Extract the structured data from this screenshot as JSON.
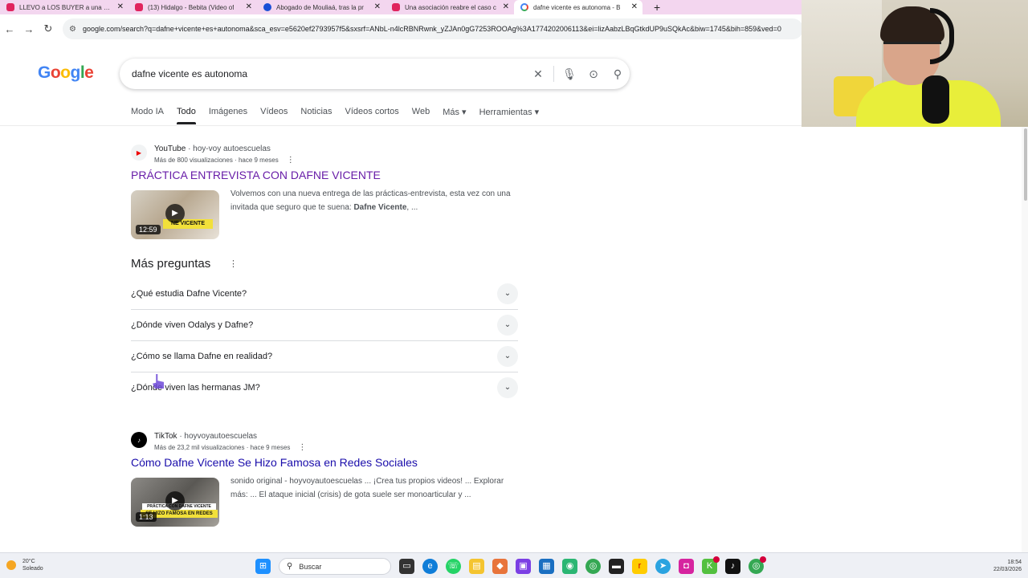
{
  "browser": {
    "tabs": [
      {
        "title": "LLEVO a LOS BUYER a una CLA",
        "favicon": "youtube-icon"
      },
      {
        "title": "(13) Hidalgo - Bebita (Video of",
        "favicon": "youtube-icon"
      },
      {
        "title": "Abogado de Mouliaá, tras la pr",
        "favicon": "facebook-icon"
      },
      {
        "title": "Una asociación reabre el caso c",
        "favicon": "youtube-icon"
      },
      {
        "title": "dafne vicente es autonoma - B",
        "favicon": "google-icon"
      }
    ],
    "new_tab": "+",
    "url": "google.com/search?q=dafne+vicente+es+autonoma&sca_esv=e5620ef2793957f5&sxsrf=ANbL-n4lcRBNRwnk_yZJAn0gG7253ROOAg%3A1774202006113&ei=lizAabzLBqGtkdUP9uSQkAc&biw=1745&bih=859&ved=0"
  },
  "search": {
    "logo": [
      "G",
      "o",
      "o",
      "g",
      "l",
      "e"
    ],
    "query": "dafne vicente es autonoma",
    "tabs": [
      "Modo IA",
      "Todo",
      "Imágenes",
      "Vídeos",
      "Noticias",
      "Vídeos cortos",
      "Web",
      "Más ▾",
      "Herramientas ▾"
    ]
  },
  "results": [
    {
      "source": "YouTube",
      "source_sub": "· hoy-voy autoescuelas",
      "meta": "Más de 800 visualizaciones · hace 9 meses",
      "title": "PRÁCTICA ENTREVISTA CON DAFNE VICENTE",
      "duration": "12:59",
      "thumb_text": "NE VICENTE",
      "snippet": "Volvemos con una nueva entrega de las prácticas-entrevista, esta vez con una invitada que seguro que te suena:",
      "snippet_bold": "Dafne Vicente",
      "snippet_end": ", ..."
    },
    {
      "source": "TikTok",
      "source_sub": "· hoyvoyautoescuelas",
      "meta": "Más de 23,2 mil visualizaciones · hace 9 meses",
      "title": "Cómo Dafne Vicente Se Hizo Famosa en Redes Sociales",
      "duration": "1:13",
      "thumb_text_top": "PRÁCTICA CON DAFNE VICENTE",
      "thumb_text": "SE HIZO FAMOSA EN REDES",
      "snippet": "sonido original - hoyvoyautoescuelas ... ¡Crea tus propios videos! ... Explorar más: ... El ataque inicial (crisis) de gota suele ser monoarticular y ..."
    }
  ],
  "paa": {
    "title": "Más preguntas",
    "items": [
      "¿Qué estudia Dafne Vicente?",
      "¿Dónde viven Odalys y Dafne?",
      "¿Cómo se llama Dafne en realidad?",
      "¿Dónde viven las hermanas JM?"
    ]
  },
  "taskbar": {
    "weather_temp": "20°C",
    "weather_desc": "Soleado",
    "search_placeholder": "Buscar",
    "time": "18:54",
    "date": "22/03/2026"
  }
}
